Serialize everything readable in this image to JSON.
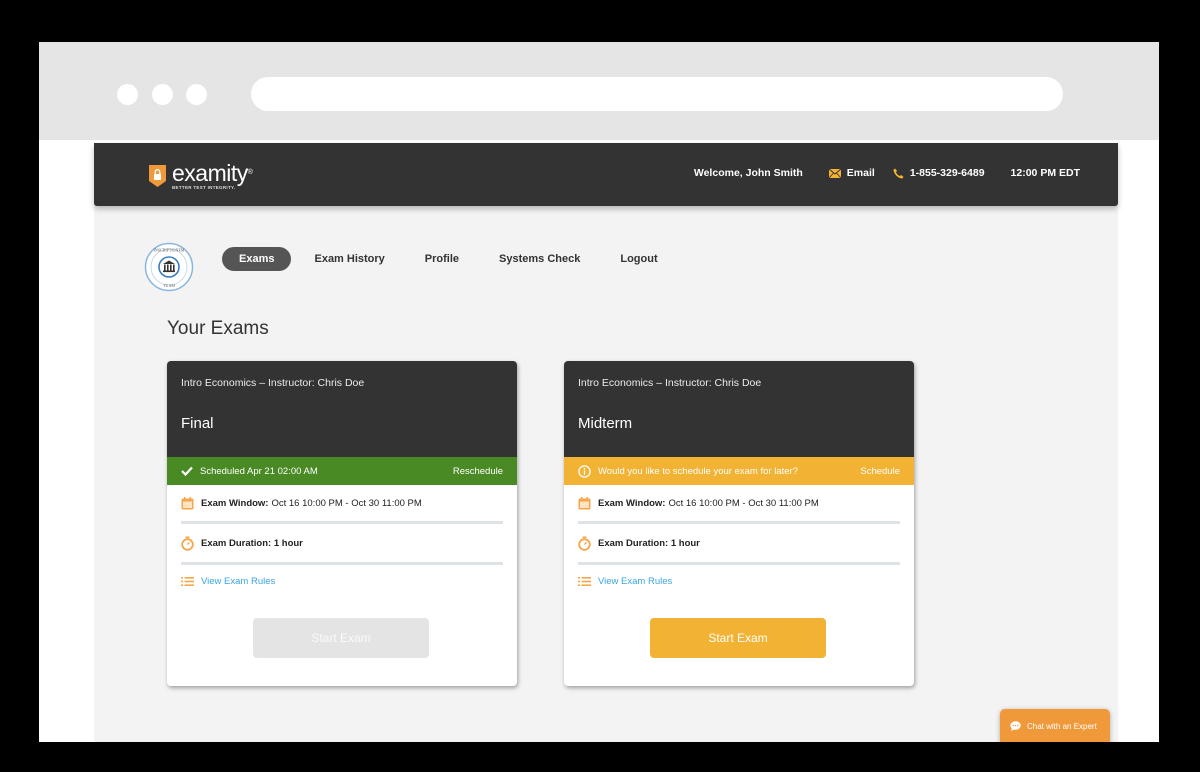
{
  "browser": {
    "window_dots": [
      "dot-1",
      "dot-2",
      "dot-3"
    ],
    "address_bar_value": ""
  },
  "header": {
    "brand_name": "examity",
    "brand_mark": "®",
    "tagline": "BETTER TEST INTEGRITY.",
    "welcome": "Welcome, John Smith",
    "email_label": "Email",
    "phone": "1-855-329-6489",
    "time": "12:00 PM EDT",
    "icons": {
      "logo": "lock-shield-icon",
      "email": "envelope-icon",
      "phone": "phone-icon"
    }
  },
  "nav": {
    "seal_alt": "Institution seal",
    "seal_top_text": "INSCRIPTIONEM",
    "seal_bottom_text": "TUAM",
    "items": [
      {
        "label": "Exams",
        "active": true
      },
      {
        "label": "Exam History",
        "active": false
      },
      {
        "label": "Profile",
        "active": false
      },
      {
        "label": "Systems Check",
        "active": false
      },
      {
        "label": "Logout",
        "active": false
      }
    ]
  },
  "main": {
    "title": "Your Exams",
    "cards": [
      {
        "course": "Intro Economics – Instructor: Chris Doe",
        "exam": "Final",
        "banner": {
          "status": "scheduled",
          "text": "Scheduled Apr 21 02:00 AM",
          "action": "Reschedule",
          "color": "#4a8a25",
          "icon": "check-icon"
        },
        "window_label": "Exam Window:",
        "window_value": "Oct 16 10:00 PM - Oct 30 11:00 PM",
        "duration_label": "Exam Duration: 1 hour",
        "rules_link": "View Exam Rules",
        "start_button": {
          "label": "Start Exam",
          "enabled": false
        }
      },
      {
        "course": "Intro Economics – Instructor: Chris Doe",
        "exam": "Midterm",
        "banner": {
          "status": "unscheduled",
          "text": "Would you like to schedule your exam for later?",
          "action": "Schedule",
          "color": "#f2b233",
          "icon": "info-icon"
        },
        "window_label": "Exam Window:",
        "window_value": "Oct 16 10:00 PM - Oct 30 11:00 PM",
        "duration_label": "Exam Duration: 1 hour",
        "rules_link": "View Exam Rules",
        "start_button": {
          "label": "Start Exam",
          "enabled": true
        }
      }
    ]
  },
  "chat": {
    "label": "Chat with an Expert",
    "color": "#f0993a"
  },
  "colors": {
    "accent_orange": "#f0993a",
    "accent_yellow": "#f2b233",
    "success_green": "#4a8a25",
    "header_dark": "#333333",
    "link_blue": "#3aa6e2"
  }
}
